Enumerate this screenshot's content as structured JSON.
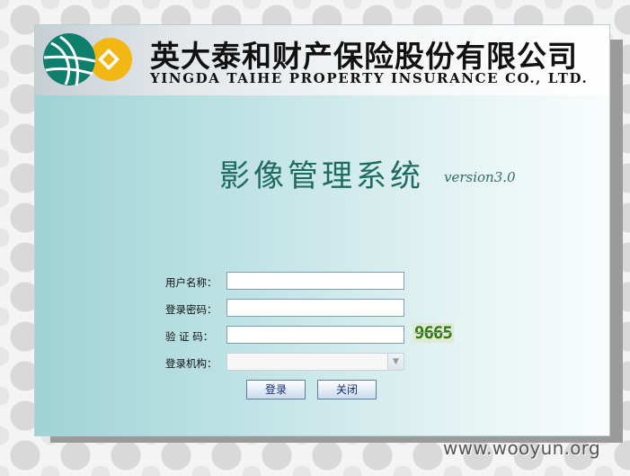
{
  "header": {
    "company_cn": "英大泰和财产保险股份有限公司",
    "company_en": "YINGDA TAIHE PROPERTY INSURANCE CO., LTD.",
    "logo_icon": "globe-coin-logo-icon"
  },
  "system": {
    "title": "影像管理系统",
    "version": "version3.0"
  },
  "form": {
    "username_label": "用户名称：",
    "username_value": "",
    "password_label": "登录密码：",
    "password_value": "",
    "captcha_label": "验 证 码：",
    "captcha_value": "",
    "captcha_image_text": "9665",
    "org_label": "登录机构：",
    "org_selected": "",
    "login_button": "登录",
    "close_button": "关闭"
  },
  "watermark": "www.wooyun.org",
  "colors": {
    "title": "#1e6c5f",
    "panel_gradient_start": "#9fd3d6",
    "button_text": "#102d7a",
    "captcha": "#2e7a13"
  }
}
